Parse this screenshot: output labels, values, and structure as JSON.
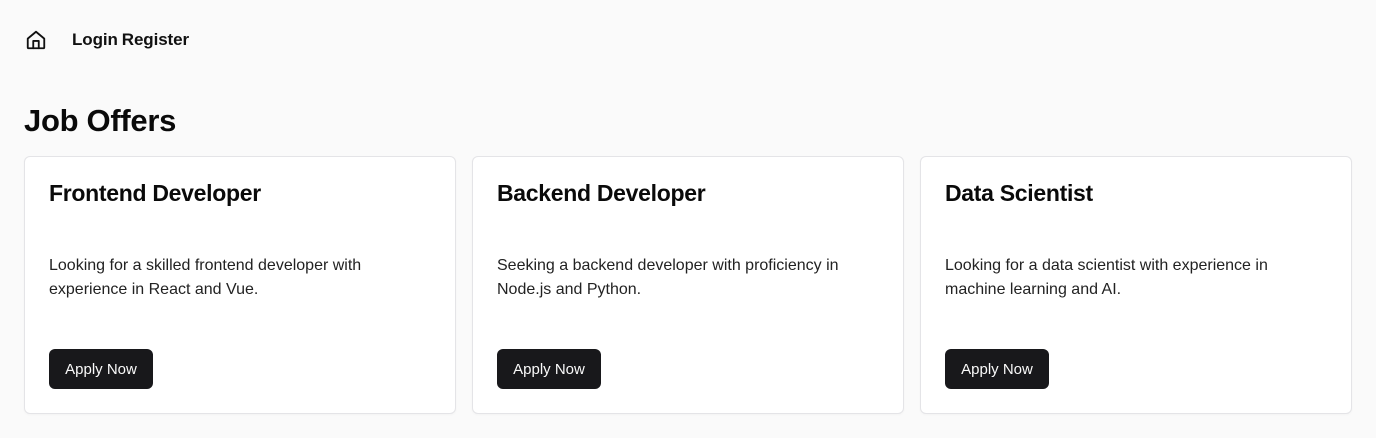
{
  "nav": {
    "home_icon": "home-icon",
    "login_label": "Login",
    "register_label": "Register"
  },
  "page_title": "Job Offers",
  "jobs": [
    {
      "title": "Frontend Developer",
      "description": "Looking for a skilled frontend developer with experience in React and Vue.",
      "button_label": "Apply Now"
    },
    {
      "title": "Backend Developer",
      "description": "Seeking a backend developer with proficiency in Node.js and Python.",
      "button_label": "Apply Now"
    },
    {
      "title": "Data Scientist",
      "description": "Looking for a data scientist with experience in machine learning and AI.",
      "button_label": "Apply Now"
    }
  ],
  "colors": {
    "background": "#fafafa",
    "card_background": "#ffffff",
    "card_border": "#e4e4e7",
    "button_background": "#18181b",
    "button_text": "#fafafa"
  }
}
